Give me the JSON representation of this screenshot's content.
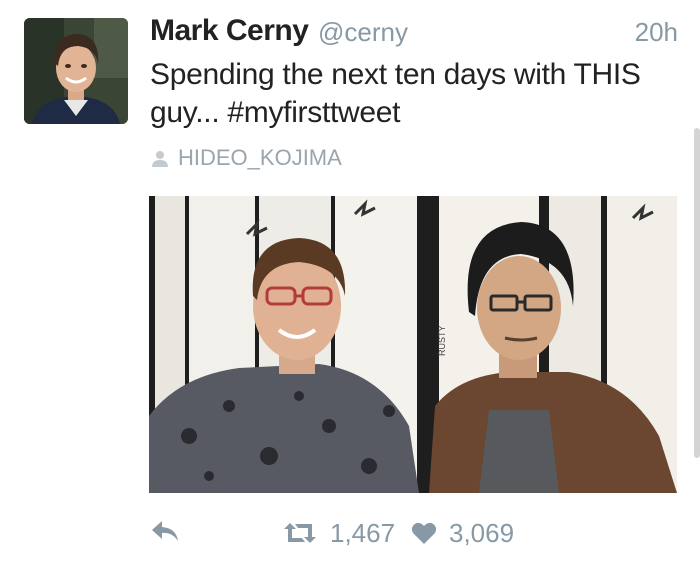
{
  "tweet": {
    "author_name": "Mark Cerny",
    "author_handle": "@cerny",
    "timestamp": "20h",
    "text_line1": "Spending the next ten days with THIS",
    "text_line2": "guy... #myfirsttweet",
    "tagged_user": "HIDEO_KOJIMA",
    "photo_sign_text": "RUSTY"
  },
  "actions": {
    "retweet_count": "1,467",
    "like_count": "3,069"
  },
  "icons": {
    "reply": "reply-icon",
    "retweet": "retweet-icon",
    "like": "heart-icon",
    "tagged": "person-icon"
  },
  "colors": {
    "name": "#222222",
    "meta": "#8899a6",
    "tag": "#9aa5ad"
  }
}
